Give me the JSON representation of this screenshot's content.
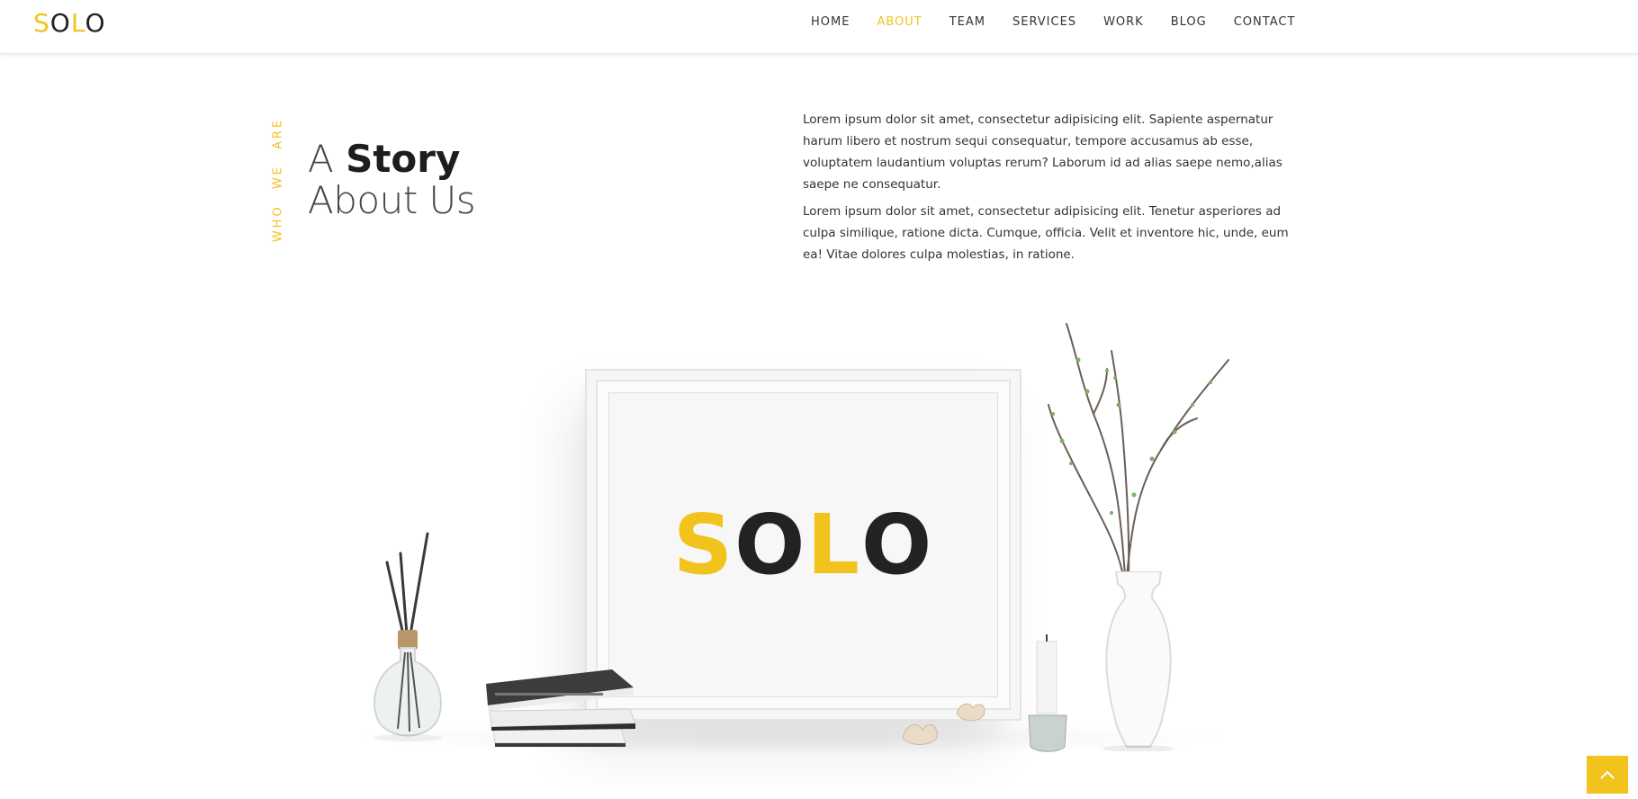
{
  "header": {
    "logo": {
      "letters": [
        "S",
        "O",
        "L",
        "O"
      ]
    },
    "nav": [
      {
        "label": "HOME",
        "active": false
      },
      {
        "label": "ABOUT",
        "active": true
      },
      {
        "label": "TEAM",
        "active": false
      },
      {
        "label": "SERVICES",
        "active": false
      },
      {
        "label": "WORK",
        "active": false
      },
      {
        "label": "BLOG",
        "active": false
      },
      {
        "label": "CONTACT",
        "active": false
      }
    ]
  },
  "about": {
    "vertical_label": "WHO WE ARE",
    "title_line1_prefix": "A",
    "title_line1_bold": "Story",
    "title_line2": "About Us",
    "paragraphs": [
      "Lorem ipsum dolor sit amet, consectetur adipisicing elit. Sapiente aspernatur harum libero et nostrum sequi consequatur, tempore accusamus ab esse, voluptatem laudantium voluptas rerum? Laborum id ad alias saepe nemo,alias saepe ne consequatur.",
      "Lorem ipsum dolor sit amet, consectetur adipisicing elit. Tenetur asperiores ad culpa similique, ratione dicta. Cumque, officia. Velit et inventore hic, unde, eum ea! Vitae dolores culpa molestias, in ratione."
    ]
  },
  "illustration": {
    "frame_logo": [
      "S",
      "O",
      "L",
      "O"
    ]
  },
  "colors": {
    "accent": "#f2c21d",
    "text_dark": "#222222",
    "background": "#ffffff"
  },
  "icons": {
    "scroll_top": "chevron-up-icon"
  }
}
